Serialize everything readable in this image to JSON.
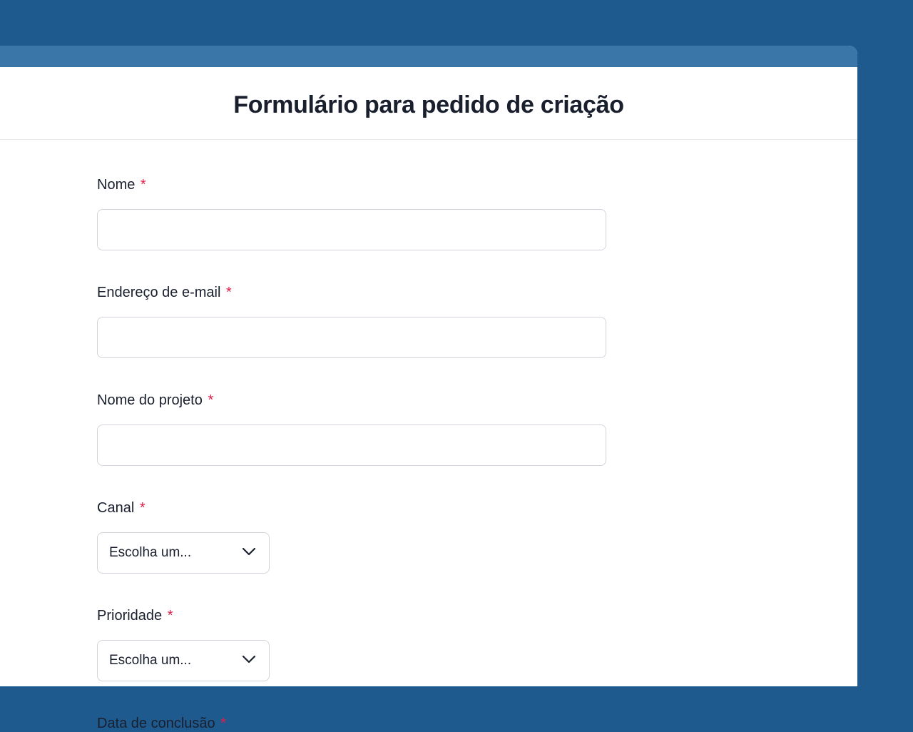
{
  "form": {
    "title": "Formulário para pedido de criação",
    "required_mark": "*",
    "fields": {
      "name": {
        "label": "Nome",
        "value": ""
      },
      "email": {
        "label": "Endereço de e-mail",
        "value": ""
      },
      "project_name": {
        "label": "Nome do projeto",
        "value": ""
      },
      "channel": {
        "label": "Canal",
        "placeholder": "Escolha um..."
      },
      "priority": {
        "label": "Prioridade",
        "placeholder": "Escolha um..."
      },
      "completion_date": {
        "label": "Data de conclusão"
      }
    }
  }
}
